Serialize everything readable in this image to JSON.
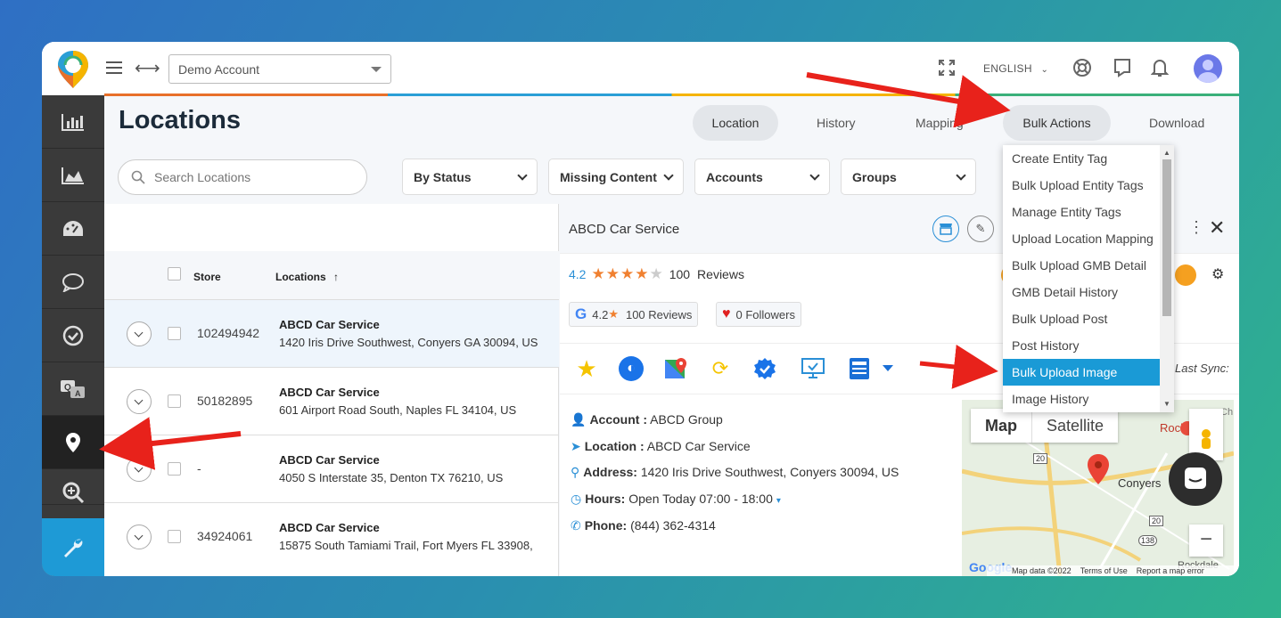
{
  "topbar": {
    "account_select": "Demo Account",
    "language": "ENGLISH",
    "icons": [
      "menu-icon",
      "expand-arrows-icon",
      "fullscreen-icon",
      "lifebuoy-icon",
      "chat-icon",
      "bell-icon",
      "avatar"
    ]
  },
  "sidebar": {
    "items": [
      "analytics-icon",
      "area-chart-icon",
      "dashboard-icon",
      "comment-icon",
      "check-icon",
      "qa-icon",
      "location-pin-icon",
      "zoom-icon",
      "wrench-icon"
    ]
  },
  "page": {
    "title": "Locations",
    "tabs": [
      {
        "label": "Location",
        "active": true
      },
      {
        "label": "History",
        "active": false
      },
      {
        "label": "Mapping",
        "active": false
      },
      {
        "label": "Bulk Actions",
        "active": false
      },
      {
        "label": "Download",
        "active": false
      }
    ]
  },
  "filters": {
    "search_placeholder": "Search Locations",
    "dropdowns": [
      "By Status",
      "Missing Content",
      "Accounts",
      "Groups"
    ]
  },
  "table": {
    "col_store": "Store",
    "col_locations": "Locations",
    "rows": [
      {
        "store": "102494942",
        "name": "ABCD Car Service",
        "address": "1420 Iris Drive Southwest, Conyers GA 30094, US"
      },
      {
        "store": "50182895",
        "name": "ABCD Car Service",
        "address": "601 Airport Road South, Naples FL 34104, US"
      },
      {
        "store": "-",
        "name": "ABCD Car Service",
        "address": "4050 S Interstate 35, Denton TX 76210, US"
      },
      {
        "store": "34924061",
        "name": "ABCD Car Service",
        "address": "15875 South Tamiami Trail, Fort Myers FL 33908,"
      }
    ]
  },
  "detail": {
    "name": "ABCD Car Service",
    "rating": "4.2",
    "review_count": "100",
    "reviews_label": "Reviews",
    "google_rating": "4.2",
    "google_reviews": "100 Reviews",
    "followers": "0 Followers",
    "last_sync_label": "Last Sync:",
    "account_label": "Account :",
    "account_value": "ABCD Group",
    "location_label": "Location :",
    "location_value": "ABCD Car Service",
    "address_label": "Address:",
    "address_value": "1420 Iris Drive Southwest, Conyers 30094, US",
    "hours_label": "Hours:",
    "hours_value": "Open Today 07:00 - 18:00",
    "phone_label": "Phone:",
    "phone_value": "(844) 362-4314"
  },
  "map": {
    "btn_map": "Map",
    "btn_satellite": "Satellite",
    "label_conyers": "Conyers",
    "label_rockdale": "Rockdale",
    "label_rockdale2": "Rockdale",
    "road_20": "20",
    "road_20b": "20",
    "road_138": "138",
    "label_ch": "Ch",
    "footer_data": "Map data ©2022",
    "footer_terms": "Terms of Use",
    "footer_report": "Report a map error",
    "google": "Google"
  },
  "bulk_menu": {
    "items": [
      "Create Entity Tag",
      "Bulk Upload Entity Tags",
      "Manage Entity Tags",
      "Upload Location Mapping",
      "Bulk Upload GMB Detail",
      "GMB Detail History",
      "Bulk Upload Post",
      "Post History",
      "Bulk Upload Image",
      "Image History"
    ],
    "highlighted_index": 8
  },
  "colors": {
    "accent": "#1a9ad6",
    "sidebar": "#3a3a3a",
    "arrow": "#e8221b"
  }
}
